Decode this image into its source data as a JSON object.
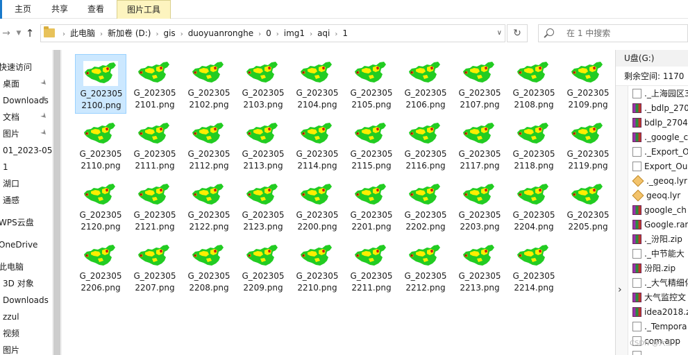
{
  "ribbon": {
    "tabs": [
      "主页",
      "共享",
      "查看"
    ],
    "active_tab": "图片工具",
    "accent": "#1979ca"
  },
  "address": {
    "crumbs": [
      "此电脑",
      "新加卷 (D:)",
      "gis",
      "duoyuanronghe",
      "0",
      "img1",
      "aqi",
      "1"
    ],
    "search_placeholder": "在 1 中搜索"
  },
  "nav": {
    "items": [
      {
        "label": "快速访问",
        "pinned": false
      },
      {
        "label": "桌面",
        "pinned": true
      },
      {
        "label": "Downloads",
        "pinned": true
      },
      {
        "label": "文档",
        "pinned": true
      },
      {
        "label": "图片",
        "pinned": true
      },
      {
        "label": "01_2023-05-",
        "pinned": false
      },
      {
        "label": "1",
        "pinned": false
      },
      {
        "label": "湖口",
        "pinned": false
      },
      {
        "label": "通感",
        "pinned": false
      },
      {
        "label": "WPS云盘",
        "pinned": false
      },
      {
        "label": "OneDrive",
        "pinned": false
      },
      {
        "label": "此电脑",
        "pinned": false
      },
      {
        "label": "3D 对象",
        "pinned": false
      },
      {
        "label": "Downloads",
        "pinned": false
      },
      {
        "label": "zzul",
        "pinned": false
      },
      {
        "label": "视频",
        "pinned": false
      },
      {
        "label": "图片",
        "pinned": false
      }
    ]
  },
  "files": [
    {
      "line1": "G_202305",
      "line2": "2100.png",
      "selected": true
    },
    {
      "line1": "G_202305",
      "line2": "2101.png"
    },
    {
      "line1": "G_202305",
      "line2": "2102.png"
    },
    {
      "line1": "G_202305",
      "line2": "2103.png"
    },
    {
      "line1": "G_202305",
      "line2": "2104.png"
    },
    {
      "line1": "G_202305",
      "line2": "2105.png"
    },
    {
      "line1": "G_202305",
      "line2": "2106.png"
    },
    {
      "line1": "G_202305",
      "line2": "2107.png"
    },
    {
      "line1": "G_202305",
      "line2": "2108.png"
    },
    {
      "line1": "G_202305",
      "line2": "2109.png"
    },
    {
      "line1": "G_202305",
      "line2": "2110.png"
    },
    {
      "line1": "G_202305",
      "line2": "2111.png"
    },
    {
      "line1": "G_202305",
      "line2": "2112.png"
    },
    {
      "line1": "G_202305",
      "line2": "2113.png"
    },
    {
      "line1": "G_202305",
      "line2": "2114.png"
    },
    {
      "line1": "G_202305",
      "line2": "2115.png"
    },
    {
      "line1": "G_202305",
      "line2": "2116.png"
    },
    {
      "line1": "G_202305",
      "line2": "2117.png"
    },
    {
      "line1": "G_202305",
      "line2": "2118.png"
    },
    {
      "line1": "G_202305",
      "line2": "2119.png"
    },
    {
      "line1": "G_202305",
      "line2": "2120.png"
    },
    {
      "line1": "G_202305",
      "line2": "2121.png"
    },
    {
      "line1": "G_202305",
      "line2": "2122.png"
    },
    {
      "line1": "G_202305",
      "line2": "2123.png"
    },
    {
      "line1": "G_202305",
      "line2": "2200.png"
    },
    {
      "line1": "G_202305",
      "line2": "2201.png"
    },
    {
      "line1": "G_202305",
      "line2": "2202.png"
    },
    {
      "line1": "G_202305",
      "line2": "2203.png"
    },
    {
      "line1": "G_202305",
      "line2": "2204.png"
    },
    {
      "line1": "G_202305",
      "line2": "2205.png"
    },
    {
      "line1": "G_202305",
      "line2": "2206.png"
    },
    {
      "line1": "G_202305",
      "line2": "2207.png"
    },
    {
      "line1": "G_202305",
      "line2": "2208.png"
    },
    {
      "line1": "G_202305",
      "line2": "2209.png"
    },
    {
      "line1": "G_202305",
      "line2": "2210.png"
    },
    {
      "line1": "G_202305",
      "line2": "2211.png"
    },
    {
      "line1": "G_202305",
      "line2": "2212.png"
    },
    {
      "line1": "G_202305",
      "line2": "2213.png"
    },
    {
      "line1": "G_202305",
      "line2": "2214.png"
    }
  ],
  "usb": {
    "title": "U盘(G:)",
    "free_space": "剩余空间: 1170",
    "items": [
      {
        "label": "._上海园区3",
        "icon": "doc"
      },
      {
        "label": "._bdlp_2704",
        "icon": "zip"
      },
      {
        "label": "bdlp_2704",
        "icon": "zip"
      },
      {
        "label": "._google_c",
        "icon": "zip"
      },
      {
        "label": "._Export_O",
        "icon": "doc"
      },
      {
        "label": "Export_Ou",
        "icon": "doc"
      },
      {
        "label": "._geoq.lyr",
        "icon": "lyr"
      },
      {
        "label": "geoq.lyr",
        "icon": "lyr"
      },
      {
        "label": "google_ch",
        "icon": "zip"
      },
      {
        "label": "Google.rar",
        "icon": "zip"
      },
      {
        "label": "._汾阳.zip",
        "icon": "zip"
      },
      {
        "label": "._中节能大",
        "icon": "doc"
      },
      {
        "label": "汾阳.zip",
        "icon": "zip"
      },
      {
        "label": "._大气精细化",
        "icon": "doc"
      },
      {
        "label": "大气监控文",
        "icon": "zip"
      },
      {
        "label": "idea2018.z",
        "icon": "zip"
      },
      {
        "label": "._Tempora",
        "icon": "doc"
      },
      {
        "label": "com.app",
        "icon": "doc"
      },
      {
        "label": "",
        "icon": "doc"
      }
    ]
  },
  "watermark": "CSDN @大王"
}
